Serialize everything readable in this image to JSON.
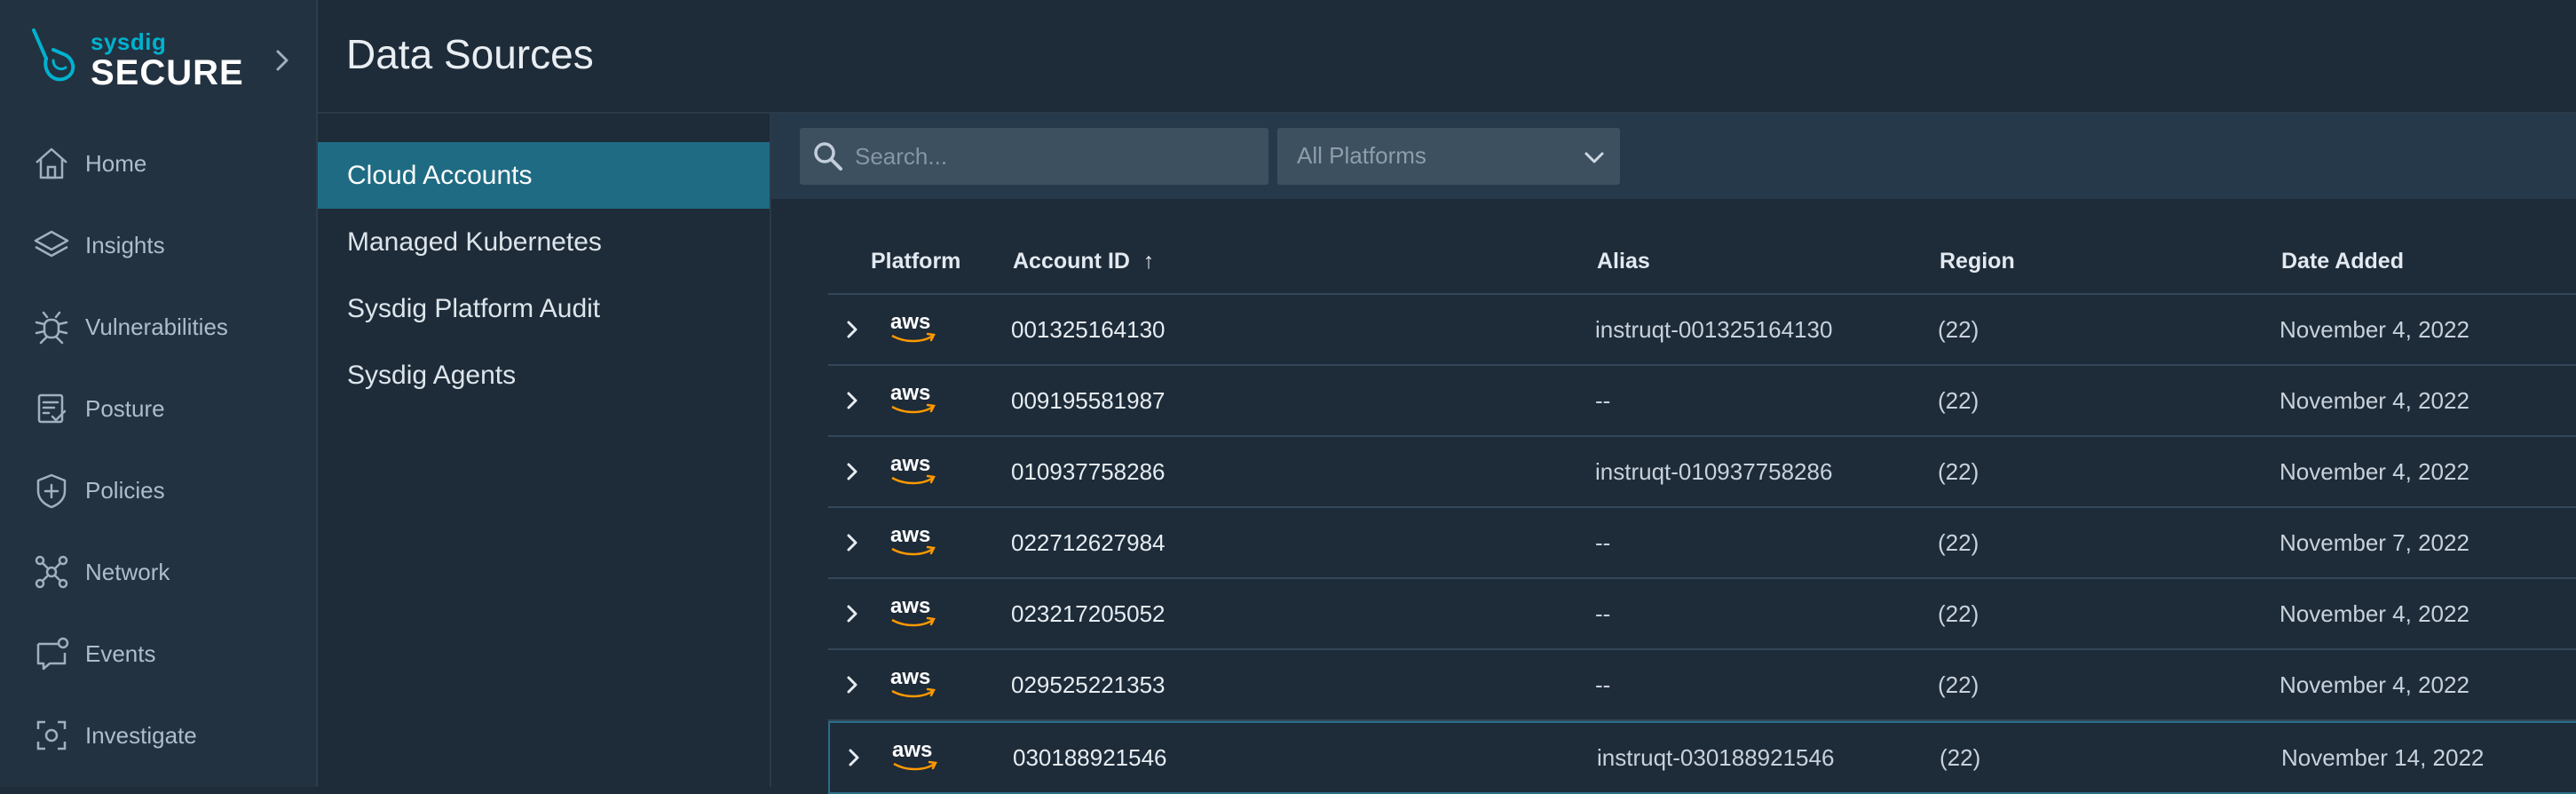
{
  "brand": {
    "small": "sysdig",
    "big": "SECURE"
  },
  "nav": [
    {
      "name": "home",
      "label": "Home",
      "icon": "home-icon"
    },
    {
      "name": "insights",
      "label": "Insights",
      "icon": "layers-icon"
    },
    {
      "name": "vulnerabilities",
      "label": "Vulnerabilities",
      "icon": "bug-icon"
    },
    {
      "name": "posture",
      "label": "Posture",
      "icon": "checklist-icon"
    },
    {
      "name": "policies",
      "label": "Policies",
      "icon": "shield-plus-icon"
    },
    {
      "name": "network",
      "label": "Network",
      "icon": "network-icon"
    },
    {
      "name": "events",
      "label": "Events",
      "icon": "chat-icon"
    },
    {
      "name": "investigate",
      "label": "Investigate",
      "icon": "focus-icon"
    }
  ],
  "page": {
    "title": "Data Sources"
  },
  "subnav": [
    {
      "label": "Cloud Accounts",
      "active": true
    },
    {
      "label": "Managed Kubernetes",
      "active": false
    },
    {
      "label": "Sysdig Platform Audit",
      "active": false
    },
    {
      "label": "Sysdig Agents",
      "active": false
    }
  ],
  "toolbar": {
    "search_placeholder": "Search...",
    "platform_filter": "All Platforms"
  },
  "table": {
    "columns": {
      "platform": "Platform",
      "account_id": "Account ID",
      "sort_indicator": "↑",
      "alias": "Alias",
      "region": "Region",
      "date_added": "Date Added"
    },
    "platform_label": "aws",
    "rows": [
      {
        "account_id": "001325164130",
        "alias": "instruqt-001325164130",
        "region": "(22)",
        "date_added": "November 4, 2022"
      },
      {
        "account_id": "009195581987",
        "alias": "--",
        "region": "(22)",
        "date_added": "November 4, 2022"
      },
      {
        "account_id": "010937758286",
        "alias": "instruqt-010937758286",
        "region": "(22)",
        "date_added": "November 4, 2022"
      },
      {
        "account_id": "022712627984",
        "alias": "--",
        "region": "(22)",
        "date_added": "November 7, 2022"
      },
      {
        "account_id": "023217205052",
        "alias": "--",
        "region": "(22)",
        "date_added": "November 4, 2022"
      },
      {
        "account_id": "029525221353",
        "alias": "--",
        "region": "(22)",
        "date_added": "November 4, 2022"
      },
      {
        "account_id": "030188921546",
        "alias": "instruqt-030188921546",
        "region": "(22)",
        "date_added": "November 14, 2022"
      }
    ]
  },
  "colors": {
    "accent": "#00b2cf",
    "active": "#1f6b83",
    "aws_orange": "#ff9900"
  }
}
